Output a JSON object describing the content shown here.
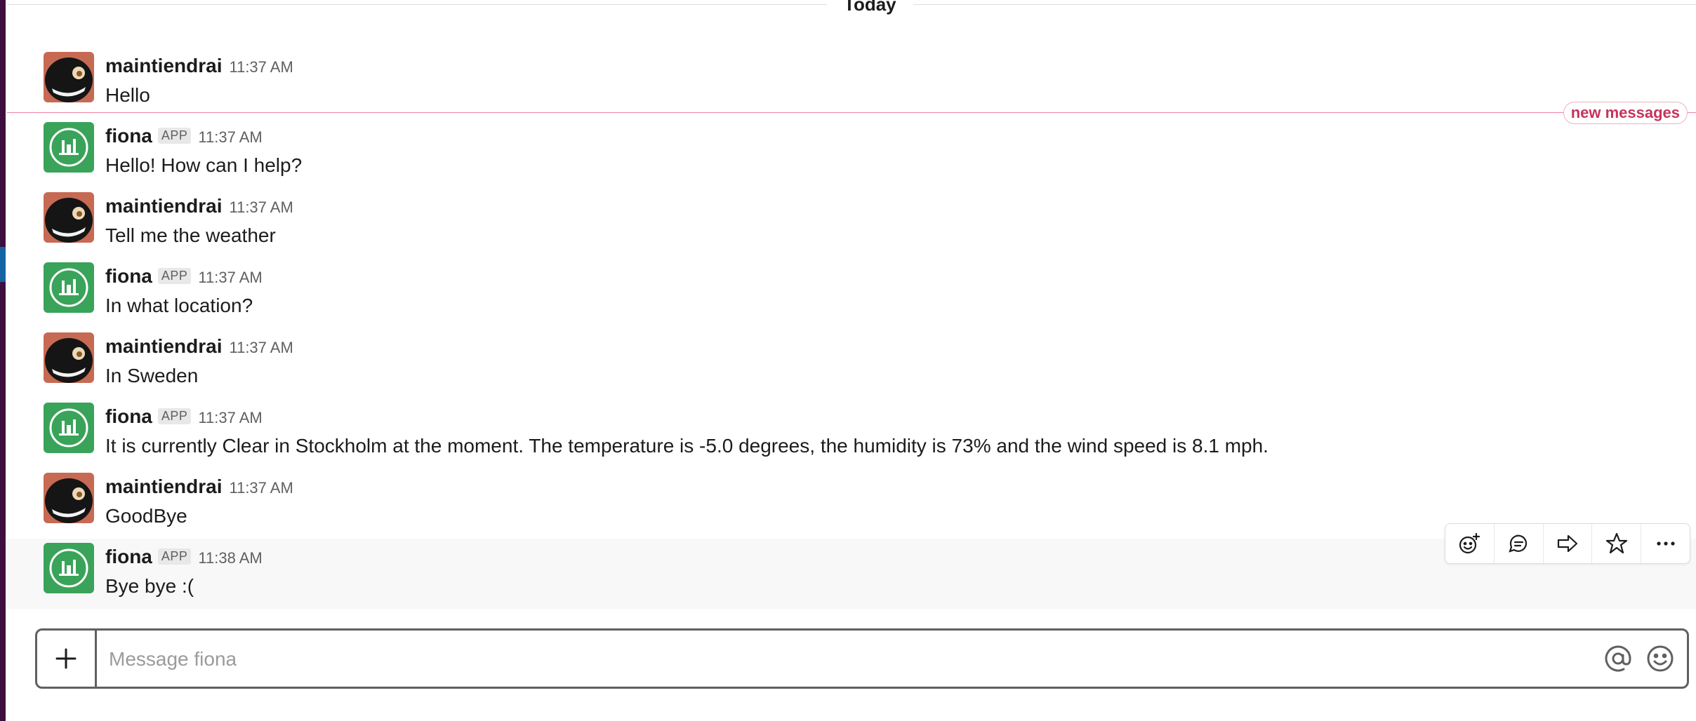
{
  "day_divider": {
    "label": "Today"
  },
  "new_messages_label": "new messages",
  "messages": [
    {
      "author": "maintiendrai",
      "is_app": false,
      "time": "11:37 AM",
      "text": "Hello"
    },
    {
      "author": "fiona",
      "is_app": true,
      "badge": "APP",
      "time": "11:37 AM",
      "text": "Hello! How can I help?"
    },
    {
      "author": "maintiendrai",
      "is_app": false,
      "time": "11:37 AM",
      "text": "Tell me the weather"
    },
    {
      "author": "fiona",
      "is_app": true,
      "badge": "APP",
      "time": "11:37 AM",
      "text": "In what location?"
    },
    {
      "author": "maintiendrai",
      "is_app": false,
      "time": "11:37 AM",
      "text": "In Sweden"
    },
    {
      "author": "fiona",
      "is_app": true,
      "badge": "APP",
      "time": "11:37 AM",
      "text": "It is currently Clear in Stockholm at the moment. The temperature is -5.0 degrees, the humidity is 73% and the wind speed is 8.1 mph."
    },
    {
      "author": "maintiendrai",
      "is_app": false,
      "time": "11:37 AM",
      "text": "GoodBye"
    },
    {
      "author": "fiona",
      "is_app": true,
      "badge": "APP",
      "time": "11:38 AM",
      "text": "Bye bye :("
    }
  ],
  "message_actions": [
    "add-reaction-icon",
    "reply-thread-icon",
    "share-icon",
    "star-icon",
    "more-actions-icon"
  ],
  "composer": {
    "placeholder": "Message fiona",
    "value": ""
  },
  "colors": {
    "sidebar": "#3f0e40",
    "accent": "#1264a3",
    "new_messages": "#e01e5a",
    "bot_avatar": "#3aa35a"
  }
}
